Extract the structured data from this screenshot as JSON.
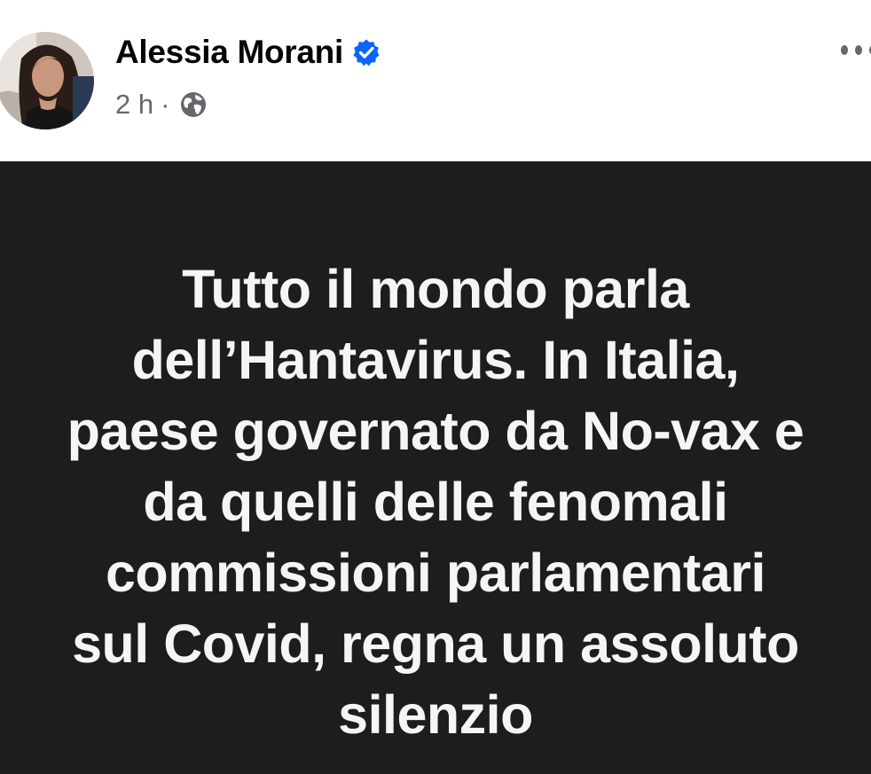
{
  "post": {
    "author": {
      "name": "Alessia Morani",
      "verified": true,
      "avatar_icon": "profile-photo"
    },
    "meta": {
      "time": "2 h",
      "separator": "·",
      "audience_icon": "globe-icon"
    },
    "more_icon": "more-options-icon",
    "card": {
      "background_color": "#1d1d1d",
      "text_color": "#f5f5f5",
      "lines": [
        "Tutto il mondo parla",
        "dell’Hantavirus. In Italia,",
        "paese governato da No-vax e",
        "da quelli delle fenomali",
        "commissioni parlamentari",
        "sul Covid, regna un assoluto",
        "silenzio"
      ]
    }
  },
  "colors": {
    "verified_blue": "#0866ff",
    "meta_gray": "#65676b",
    "name_black": "#050505"
  }
}
